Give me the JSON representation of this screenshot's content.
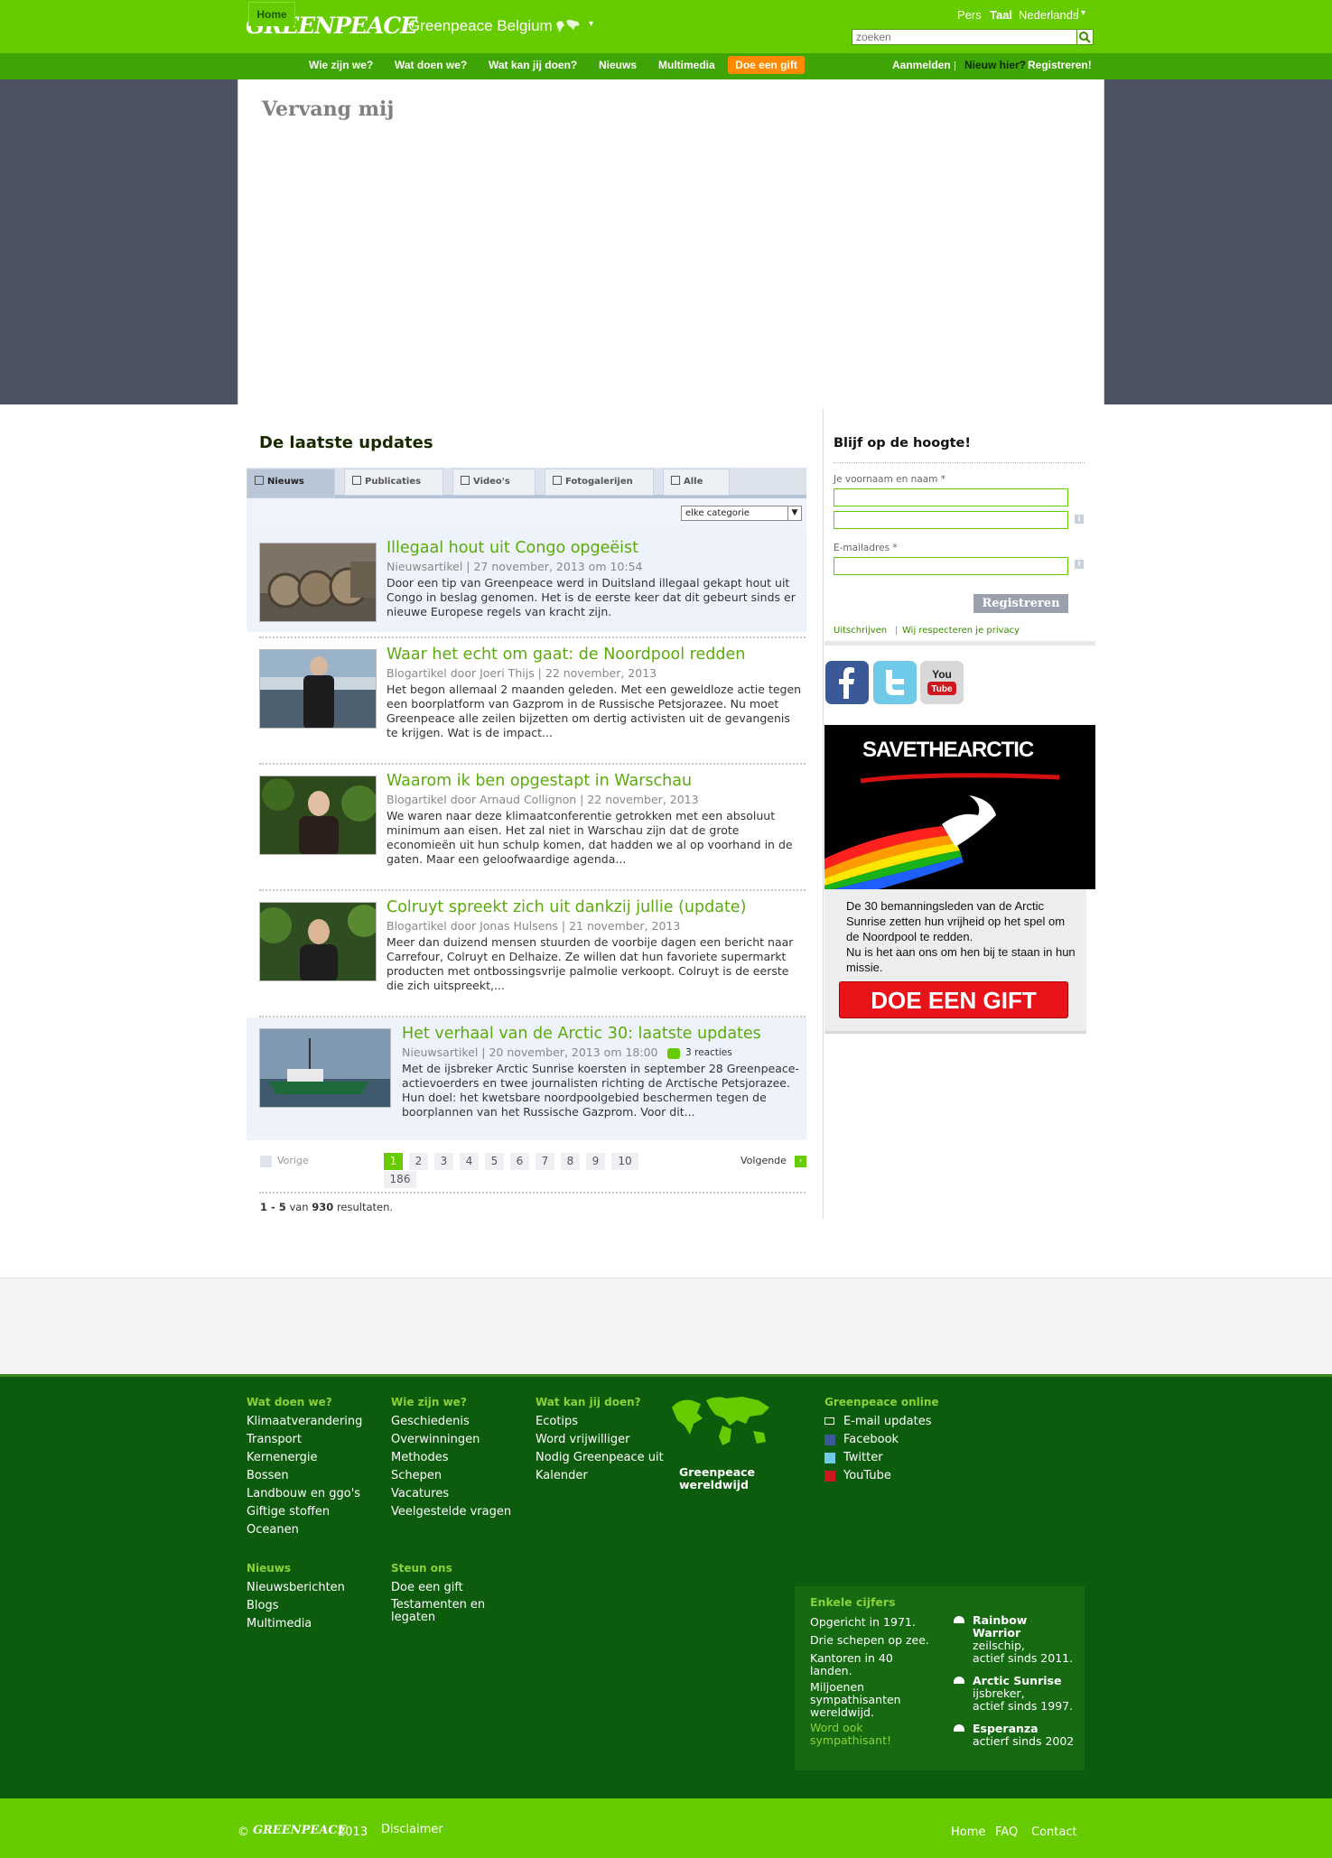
{
  "header": {
    "logo": "GREENPEACE",
    "site_name": "Greenpeace Belgium",
    "pers": "Pers",
    "taal_label": "Taal",
    "taal_value": "Nederlands",
    "search_placeholder": "zoeken"
  },
  "nav": {
    "items": [
      "Home",
      "Wie zijn we?",
      "Wat doen we?",
      "Wat kan jij doen?",
      "Nieuws",
      "Multimedia",
      "Doe een gift"
    ],
    "login": "Aanmelden",
    "new_here": "Nieuw hier?",
    "register": "Registreren!"
  },
  "hero": {
    "title": "Vervang mij"
  },
  "updates": {
    "title": "De laatste updates",
    "tabs": [
      "Nieuws",
      "Publicaties",
      "Video's",
      "Fotogalerijen",
      "Alle"
    ],
    "category": "elke categorie",
    "articles": [
      {
        "title": "Illegaal hout uit Congo opgeëist",
        "meta": "Nieuwsartikel | 27 november, 2013 om 10:54",
        "text": "Door een tip van Greenpeace werd in Duitsland illegaal gekapt hout uit Congo in beslag genomen. Het is de eerste keer dat dit gebeurt sinds er nieuwe Europese regels van kracht zijn."
      },
      {
        "title": "Waar het echt om gaat: de Noordpool redden",
        "meta": "Blogartikel door Joeri Thijs | 22 november, 2013",
        "text": "Het begon allemaal 2 maanden geleden. Met een geweldloze actie tegen een boorplatform van Gazprom in de Russische Petsjorazee. Nu moet Greenpeace alle zeilen bijzetten om dertig activisten uit de gevangenis te krijgen. Wat is de impact..."
      },
      {
        "title": "Waarom ik ben opgestapt in Warschau",
        "meta": "Blogartikel door Arnaud Collignon | 22 november, 2013",
        "text": "We waren naar deze klimaatconferentie getrokken met een absoluut minimum aan eisen. Het zal niet in Warschau zijn dat de grote economieën uit hun schulp komen, dat hadden we al op voorhand in de gaten. Maar een geloofwaardige agenda..."
      },
      {
        "title": "Colruyt spreekt zich uit dankzij jullie (update)",
        "meta": "Blogartikel door Jonas Hulsens | 21 november, 2013",
        "text": "Meer dan duizend mensen stuurden de voorbije dagen een bericht naar Carrefour, Colruyt en Delhaize. Ze willen dat hun favoriete supermarkt producten met ontbossingsvrije palmolie verkoopt. Colruyt is de eerste die zich uitspreekt,..."
      },
      {
        "title": "Het verhaal van de Arctic 30: laatste updates",
        "meta": "Nieuwsartikel | 20 november, 2013 om 18:00",
        "comments": "3 reacties",
        "text": "Met de ijsbreker Arctic Sunrise koersten in september 28 Greenpeace-actievoerders en twee journalisten richting de Arctische Petsjorazee. Hun doel: het kwetsbare noordpoolgebied beschermen tegen de boorplannen van het Russische Gazprom. Voor dit..."
      }
    ],
    "pagination": {
      "prev": "Vorige",
      "next": "Volgende",
      "pages": [
        "1",
        "2",
        "3",
        "4",
        "5",
        "6",
        "7",
        "8",
        "9",
        "10",
        "186"
      ],
      "current": "1"
    },
    "results": {
      "range": "1 - 5",
      "of": "van",
      "total": "930",
      "suffix": "resultaten."
    }
  },
  "sidebar": {
    "blijf_title": "Blijf op de hoogte!",
    "name_label": "Je voornaam en naam *",
    "email_label": "E-mailadres *",
    "register_button": "Registreren",
    "unsubscribe": "Uitschrijven",
    "privacy": "Wij respecteren je privacy",
    "social": [
      "facebook",
      "twitter",
      "youtube"
    ],
    "arctic_banner": "SAVETHEARCTIC",
    "arctic_text": "De 30 bemanningsleden van de Arctic Sunrise zetten hun vrijheid op het spel om de Noordpool te redden.",
    "arctic_text2": "Nu is het aan ons om hen bij te staan in hun missie.",
    "arctic_button": "DOE EEN GIFT"
  },
  "footer": {
    "col1": {
      "head": "Wat doen we?",
      "links": [
        "Klimaatverandering",
        "Transport",
        "Kernenergie",
        "Bossen",
        "Landbouw en ggo's",
        "Giftige stoffen",
        "Oceanen"
      ]
    },
    "col2": {
      "head": "Wie zijn we?",
      "links": [
        "Geschiedenis",
        "Overwinningen",
        "Methodes",
        "Schepen",
        "Vacatures",
        "Veelgestelde vragen"
      ]
    },
    "col3": {
      "head": "Wat kan jij doen?",
      "links": [
        "Ecotips",
        "Word vrijwilliger",
        "Nodig Greenpeace uit",
        "Kalender"
      ]
    },
    "world_label": "Greenpeace wereldwijd",
    "col5": {
      "head": "Greenpeace online",
      "links": [
        "E-mail updates",
        "Facebook",
        "Twitter",
        "YouTube"
      ]
    },
    "nieuws": {
      "head": "Nieuws",
      "links": [
        "Nieuwsberichten",
        "Blogs",
        "Multimedia"
      ]
    },
    "steun": {
      "head": "Steun ons",
      "links": [
        "Doe een gift",
        "Testamenten en legaten"
      ]
    },
    "cijfers": {
      "head": "Enkele cijfers",
      "facts": [
        "Opgericht in 1971.",
        "Drie schepen op zee.",
        "Kantoren in 40 landen.",
        "Miljoenen sympathisanten wereldwijd."
      ],
      "cta": "Word ook sympathisant!",
      "ships": [
        {
          "name": "Rainbow Warrior",
          "desc": "zeilschip,",
          "since": "actief sinds 2011."
        },
        {
          "name": "Arctic Sunrise",
          "desc": "ijsbreker,",
          "since": "actief sinds 1997."
        },
        {
          "name": "Esperanza",
          "desc": "",
          "since": "actierf sinds 2002"
        }
      ]
    },
    "bottom": {
      "copyright": "©",
      "logo": "GREENPEACE",
      "year": "2013",
      "disclaimer": "Disclaimer",
      "links": [
        "Home",
        "FAQ",
        "Contact"
      ]
    }
  },
  "colors": {
    "brand_green": "#66cc00",
    "dark_green": "#0d5c0d",
    "orange": "#ff8a00",
    "red": "#e8141a"
  }
}
